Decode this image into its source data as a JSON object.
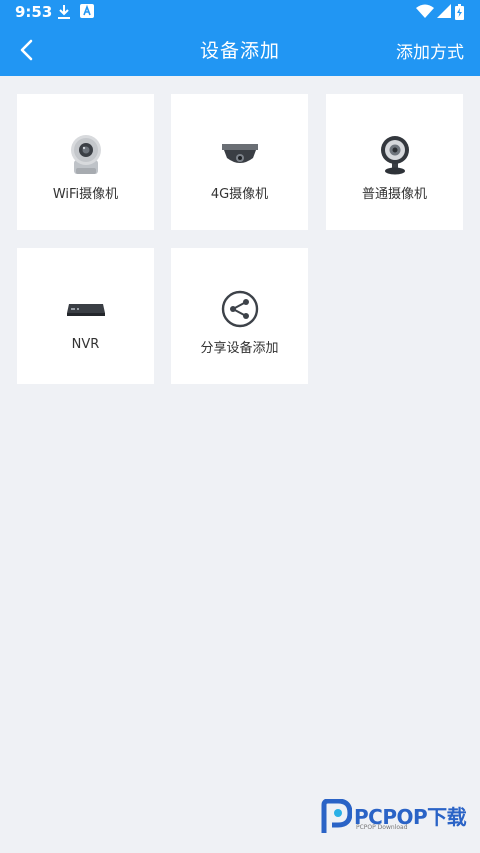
{
  "status_bar": {
    "time": "9:53",
    "left_icons": [
      "download-icon",
      "notification-a-icon"
    ],
    "right_icons": [
      "wifi-icon",
      "signal-icon",
      "battery-charging-icon"
    ]
  },
  "header": {
    "title": "设备添加",
    "action_label": "添加方式",
    "back_icon": "chevron-left-icon",
    "bg_color": "#2196f3"
  },
  "tiles": [
    {
      "label": "WiFi摄像机",
      "icon": "wifi-camera-icon"
    },
    {
      "label": "4G摄像机",
      "icon": "dome-camera-icon"
    },
    {
      "label": "普通摄像机",
      "icon": "webcam-icon"
    },
    {
      "label": "NVR",
      "icon": "nvr-icon"
    },
    {
      "label": "分享设备添加",
      "icon": "share-icon"
    }
  ],
  "watermark": {
    "brand": "PCPOP下载",
    "sub": "PCPOP Download"
  }
}
